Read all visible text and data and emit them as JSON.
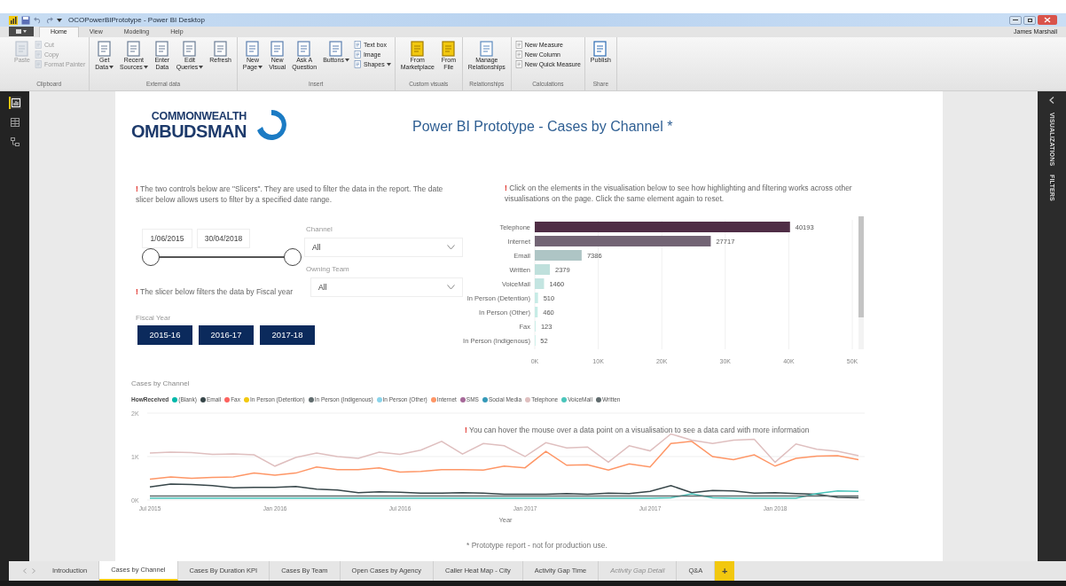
{
  "window": {
    "title": "OCOPowerBIPrototype - Power BI Desktop",
    "user": "James Marshall"
  },
  "ribbon_tabs": [
    {
      "label": "Home",
      "selected": true
    },
    {
      "label": "View",
      "selected": false
    },
    {
      "label": "Modeling",
      "selected": false
    },
    {
      "label": "Help",
      "selected": false
    }
  ],
  "ribbon_groups": [
    {
      "label": "Clipboard",
      "items": [
        {
          "kind": "large",
          "lines": [
            "Paste"
          ],
          "dropdown": false,
          "disabled": true
        },
        {
          "kind": "small",
          "lines": [
            "Cut"
          ],
          "dropdown": false,
          "disabled": true
        },
        {
          "kind": "small",
          "lines": [
            "Copy"
          ],
          "dropdown": false,
          "disabled": true
        },
        {
          "kind": "small",
          "lines": [
            "Format Painter"
          ],
          "dropdown": false,
          "disabled": true
        }
      ]
    },
    {
      "label": "External data",
      "items": [
        {
          "kind": "large",
          "lines": [
            "Get",
            "Data"
          ],
          "dropdown": true,
          "disabled": false
        },
        {
          "kind": "large",
          "lines": [
            "Recent",
            "Sources"
          ],
          "dropdown": true,
          "disabled": false
        },
        {
          "kind": "large",
          "lines": [
            "Enter",
            "Data"
          ],
          "dropdown": false,
          "disabled": false
        },
        {
          "kind": "large",
          "lines": [
            "Edit",
            "Queries"
          ],
          "dropdown": true,
          "disabled": false
        },
        {
          "kind": "large",
          "lines": [
            "Refresh"
          ],
          "dropdown": false,
          "disabled": false
        }
      ]
    },
    {
      "label": "Insert",
      "items": [
        {
          "kind": "large",
          "lines": [
            "New",
            "Page"
          ],
          "dropdown": true,
          "disabled": false
        },
        {
          "kind": "large",
          "lines": [
            "New",
            "Visual"
          ],
          "dropdown": false,
          "disabled": false
        },
        {
          "kind": "large",
          "lines": [
            "Ask A",
            "Question"
          ],
          "dropdown": false,
          "disabled": false
        },
        {
          "kind": "large",
          "lines": [
            "Buttons"
          ],
          "dropdown": true,
          "disabled": false
        },
        {
          "kind": "small",
          "lines": [
            "Text box"
          ],
          "dropdown": false,
          "disabled": false
        },
        {
          "kind": "small",
          "lines": [
            "Image"
          ],
          "dropdown": false,
          "disabled": false
        },
        {
          "kind": "small",
          "lines": [
            "Shapes"
          ],
          "dropdown": true,
          "disabled": false
        }
      ]
    },
    {
      "label": "Custom visuals",
      "items": [
        {
          "kind": "large",
          "lines": [
            "From",
            "Marketplace"
          ],
          "dropdown": false,
          "disabled": false
        },
        {
          "kind": "large",
          "lines": [
            "From",
            "File"
          ],
          "dropdown": false,
          "disabled": false
        }
      ]
    },
    {
      "label": "Relationships",
      "items": [
        {
          "kind": "large",
          "lines": [
            "Manage",
            "Relationships"
          ],
          "dropdown": false,
          "disabled": false
        }
      ]
    },
    {
      "label": "Calculations",
      "items": [
        {
          "kind": "small",
          "lines": [
            "New Measure"
          ],
          "dropdown": false,
          "disabled": false
        },
        {
          "kind": "small",
          "lines": [
            "New Column"
          ],
          "dropdown": false,
          "disabled": false
        },
        {
          "kind": "small",
          "lines": [
            "New Quick Measure"
          ],
          "dropdown": false,
          "disabled": false
        }
      ]
    },
    {
      "label": "Share",
      "items": [
        {
          "kind": "large",
          "lines": [
            "Publish"
          ],
          "dropdown": false,
          "disabled": false
        }
      ]
    }
  ],
  "views": [
    {
      "selected": true
    },
    {
      "selected": false
    },
    {
      "selected": false
    }
  ],
  "side_panel": {
    "tabs": [
      "VISUALIZATIONS",
      "FILTERS"
    ]
  },
  "report": {
    "logo": {
      "line1": "COMMONWEALTH",
      "line2": "OMBUDSMAN"
    },
    "title": "Power BI Prototype - Cases by Channel *",
    "note_slicers": {
      "mark": "!",
      "text": " The two controls below are \"Slicers\". They are used to filter the data in the report. The date slicer below allows users to filter by a specified date range."
    },
    "date_slicer": {
      "start": "1/06/2015",
      "end": "30/04/2018",
      "level": 1
    },
    "dropdowns": [
      {
        "label": "Channel",
        "value": "All"
      },
      {
        "label": "Owning Team",
        "value": "All"
      }
    ],
    "note_fiscal": {
      "mark": "!",
      "text": " The slicer below filters the data by Fiscal year"
    },
    "fiscal_slicer": {
      "label": "Fiscal Year",
      "options": [
        {
          "label": "2015-16",
          "selected": false
        },
        {
          "label": "2016-17",
          "selected": false
        },
        {
          "label": "2017-18",
          "selected": false
        }
      ]
    },
    "note_highlight": {
      "mark": "!",
      "text": " Click on the elements in the visualisation below to see how highlighting and filtering works across other visualisations on the page. Click the same element again to reset."
    },
    "bar_chart": {
      "chart_data": {
        "type": "bar",
        "orientation": "horizontal",
        "categories": [
          "Telephone",
          "Internet",
          "Email",
          "Written",
          "VoiceMail",
          "In Person (Detention)",
          "In Person (Other)",
          "Fax",
          "In Person (Indigenous)"
        ],
        "series": [
          {
            "values": [
              40193,
              27717,
              7386,
              2379,
              1460,
              510,
              460,
              123,
              52
            ]
          }
        ],
        "grid": true,
        "xlim": [
          0,
          50000
        ],
        "xticks": [
          {
            "value": 0,
            "label": "0K"
          },
          {
            "value": 10000,
            "label": "10K"
          },
          {
            "value": 20000,
            "label": "20K"
          },
          {
            "value": 30000,
            "label": "30K"
          },
          {
            "value": 40000,
            "label": "40K"
          },
          {
            "value": 50000,
            "label": "50K"
          }
        ],
        "data_labels": true
      }
    },
    "line_chart": {
      "legend_title": "HowReceived",
      "chart_data": {
        "type": "line",
        "title": "Cases by Channel",
        "xlabel": "Year",
        "categories": [
          "Jul 2015",
          null,
          null,
          null,
          null,
          null,
          "Jan 2016",
          null,
          null,
          null,
          null,
          null,
          "Jul 2016",
          null,
          null,
          null,
          null,
          null,
          "Jan 2017",
          null,
          null,
          null,
          null,
          null,
          "Jul 2017",
          null,
          null,
          null,
          null,
          null,
          "Jan 2018",
          null,
          null,
          null,
          null
        ],
        "ylim": [
          0,
          2000
        ],
        "grid": true,
        "yticks": [
          {
            "value": 0,
            "label": "0K"
          },
          {
            "value": 1000,
            "label": "1K"
          },
          {
            "value": 2000,
            "label": "2K"
          }
        ],
        "series": [
          {
            "name": "(Blank)",
            "color": "#01b8aa",
            "values": [
              null,
              null,
              null,
              null,
              null,
              null,
              null,
              null,
              null,
              null,
              null,
              null,
              null,
              null,
              null,
              null,
              null,
              null,
              null,
              null,
              null,
              null,
              null,
              null,
              null,
              null,
              null,
              null,
              null,
              null,
              null,
              null,
              null,
              null,
              null
            ]
          },
          {
            "name": "Email",
            "color": "#374649",
            "values": [
              300,
              370,
              360,
              330,
              280,
              290,
              290,
              310,
              250,
              230,
              170,
              190,
              180,
              160,
              160,
              170,
              160,
              130,
              130,
              130,
              150,
              130,
              160,
              150,
              200,
              330,
              170,
              220,
              210,
              160,
              170,
              150,
              130,
              60,
              50
            ]
          },
          {
            "name": "Fax",
            "color": "#fd625e",
            "values": [
              null,
              null,
              null,
              null,
              null,
              null,
              null,
              null,
              null,
              null,
              null,
              null,
              null,
              null,
              null,
              null,
              null,
              null,
              null,
              null,
              null,
              null,
              null,
              null,
              null,
              null,
              null,
              null,
              null,
              null,
              null,
              null,
              null,
              null,
              null
            ]
          },
          {
            "name": "In Person (Detention)",
            "color": "#f2c80f",
            "values": [
              null,
              null,
              null,
              null,
              null,
              null,
              null,
              null,
              null,
              null,
              null,
              null,
              null,
              null,
              null,
              null,
              null,
              null,
              null,
              null,
              null,
              null,
              null,
              null,
              null,
              null,
              null,
              null,
              null,
              null,
              null,
              null,
              null,
              null,
              null
            ]
          },
          {
            "name": "In Person (Indigenous)",
            "color": "#5f6b6d",
            "values": [
              null,
              null,
              null,
              null,
              null,
              null,
              null,
              null,
              null,
              null,
              null,
              null,
              null,
              null,
              null,
              null,
              null,
              null,
              null,
              null,
              null,
              null,
              null,
              null,
              null,
              null,
              null,
              null,
              null,
              null,
              null,
              null,
              null,
              null,
              null
            ]
          },
          {
            "name": "In Person (Other)",
            "color": "#8ad4eb",
            "values": [
              null,
              null,
              null,
              null,
              null,
              null,
              null,
              null,
              null,
              null,
              null,
              null,
              null,
              null,
              null,
              null,
              null,
              null,
              null,
              null,
              null,
              null,
              null,
              null,
              null,
              null,
              null,
              null,
              null,
              null,
              null,
              null,
              null,
              null,
              null
            ]
          },
          {
            "name": "Internet",
            "color": "#fe9666",
            "values": [
              480,
              530,
              500,
              520,
              530,
              620,
              570,
              620,
              760,
              700,
              700,
              740,
              640,
              660,
              700,
              700,
              690,
              780,
              740,
              1120,
              800,
              810,
              690,
              830,
              760,
              1300,
              1350,
              1000,
              930,
              1040,
              780,
              960,
              1010,
              1020,
              930
            ]
          },
          {
            "name": "SMS",
            "color": "#a66999",
            "values": [
              null,
              null,
              null,
              null,
              null,
              null,
              null,
              null,
              null,
              null,
              null,
              null,
              null,
              null,
              null,
              null,
              null,
              null,
              null,
              null,
              null,
              null,
              null,
              null,
              null,
              null,
              null,
              null,
              null,
              null,
              null,
              null,
              null,
              null,
              null
            ]
          },
          {
            "name": "Social Media",
            "color": "#3599b8",
            "values": [
              null,
              null,
              null,
              null,
              null,
              null,
              null,
              null,
              null,
              null,
              null,
              null,
              null,
              null,
              null,
              null,
              null,
              null,
              null,
              null,
              null,
              null,
              null,
              null,
              null,
              null,
              null,
              null,
              null,
              null,
              null,
              null,
              null,
              null,
              null
            ]
          },
          {
            "name": "Telephone",
            "color": "#dfbfbf",
            "values": [
              1080,
              1100,
              1090,
              1050,
              1060,
              1040,
              780,
              980,
              1080,
              1000,
              960,
              1100,
              1050,
              1150,
              1350,
              1060,
              1300,
              1250,
              1000,
              1320,
              1200,
              1220,
              870,
              1250,
              1130,
              1520,
              1380,
              1300,
              1380,
              1400,
              870,
              1290,
              1170,
              1120,
              1020
            ]
          },
          {
            "name": "VoiceMail",
            "color": "#4ac5bb",
            "values": [
              40,
              40,
              40,
              40,
              40,
              40,
              40,
              40,
              40,
              40,
              40,
              40,
              40,
              40,
              40,
              40,
              40,
              40,
              40,
              40,
              40,
              40,
              40,
              40,
              40,
              50,
              140,
              50,
              40,
              40,
              40,
              40,
              150,
              210,
              200
            ]
          },
          {
            "name": "Written",
            "color": "#5f6b6d",
            "values": [
              90,
              90,
              90,
              90,
              90,
              90,
              90,
              90,
              90,
              90,
              90,
              90,
              90,
              90,
              90,
              90,
              90,
              90,
              90,
              90,
              90,
              90,
              90,
              90,
              90,
              90,
              90,
              90,
              90,
              90,
              90,
              90,
              90,
              90,
              90
            ]
          }
        ]
      }
    },
    "note_hover": {
      "mark": "!",
      "text": " You can hover the mouse over a data point on a visualisation to see a data card with more information"
    },
    "footer": "* Prototype report - not for production use."
  },
  "pages": [
    {
      "label": "Introduction",
      "selected": false,
      "hidden": false
    },
    {
      "label": "Cases by Channel",
      "selected": true,
      "hidden": false
    },
    {
      "label": "Cases By Duration KPI",
      "selected": false,
      "hidden": false
    },
    {
      "label": "Cases By Team",
      "selected": false,
      "hidden": false
    },
    {
      "label": "Open Cases by Agency",
      "selected": false,
      "hidden": false
    },
    {
      "label": "Caller Heat Map - City",
      "selected": false,
      "hidden": false
    },
    {
      "label": "Activity Gap Time",
      "selected": false,
      "hidden": false
    },
    {
      "label": "Activity Gap Detail",
      "selected": false,
      "hidden": true
    },
    {
      "label": "Q&A",
      "selected": false,
      "hidden": false
    }
  ],
  "add_page": "+"
}
